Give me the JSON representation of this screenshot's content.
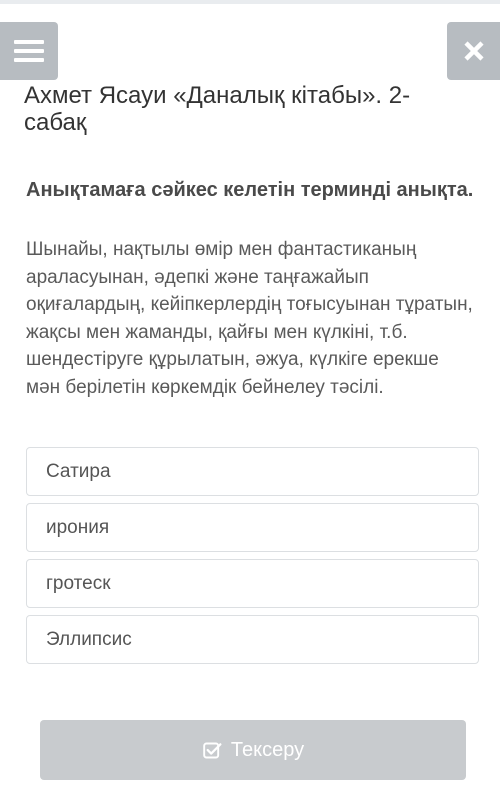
{
  "header": {
    "menu_icon": "hamburger-menu-icon",
    "close_icon": "close-x-icon"
  },
  "lesson": {
    "title": "Ахмет Ясауи «Даналық кітабы». 2-сабақ"
  },
  "question": {
    "title": "Анықтамаға сәйкес келетін терминді анықта.",
    "text": "Шынайы, нақтылы өмір мен фантастиканың араласуынан, әдепкі және таңғажайып оқиғалардың, кейіпкерлердің тоғысуынан тұратын, жақсы мен жаманды, қайғы мен күлкіні, т.б. шендестіруге құрылатын, әжуа, күлкіге ерекше мән берілетін көркемдік бейнелеу тәсілі."
  },
  "options": [
    {
      "label": "Сатира"
    },
    {
      "label": "ирония"
    },
    {
      "label": "гротеск"
    },
    {
      "label": "Эллипсис"
    }
  ],
  "submit": {
    "label": "Тексеру",
    "icon": "checkbox-check-icon"
  },
  "colors": {
    "header_button": "#b7bcc1",
    "submit_disabled": "#c8cbce",
    "option_border": "#dcdfe2"
  }
}
